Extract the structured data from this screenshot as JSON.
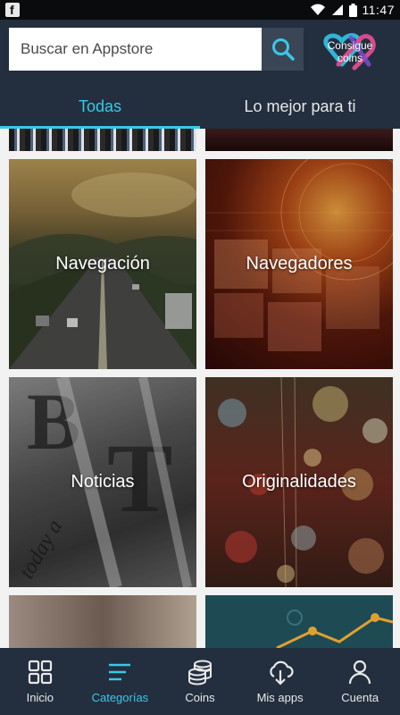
{
  "status_bar": {
    "time": "11:47",
    "left_icon": "facebook-icon"
  },
  "search": {
    "placeholder": "Buscar en Appstore"
  },
  "coins_badge": {
    "label": "Consigue coins"
  },
  "tabs": [
    {
      "label": "Todas",
      "active": true
    },
    {
      "label": "Lo mejor para ti",
      "active": false
    }
  ],
  "tiles": [
    {
      "label": "",
      "partial": true
    },
    {
      "label": "",
      "partial": true
    },
    {
      "label": "Navegación"
    },
    {
      "label": "Navegadores"
    },
    {
      "label": "Noticias"
    },
    {
      "label": "Originalidades"
    },
    {
      "label": "",
      "partial": true
    },
    {
      "label": "",
      "partial": true
    }
  ],
  "bottom_nav": [
    {
      "label": "Inicio",
      "icon": "grid-icon"
    },
    {
      "label": "Categorías",
      "icon": "list-icon",
      "active": true
    },
    {
      "label": "Coins",
      "icon": "coins-icon"
    },
    {
      "label": "Mis apps",
      "icon": "cloud-download-icon"
    },
    {
      "label": "Cuenta",
      "icon": "person-icon"
    }
  ],
  "colors": {
    "accent": "#3ac8e8",
    "header_bg": "#232f3e"
  }
}
